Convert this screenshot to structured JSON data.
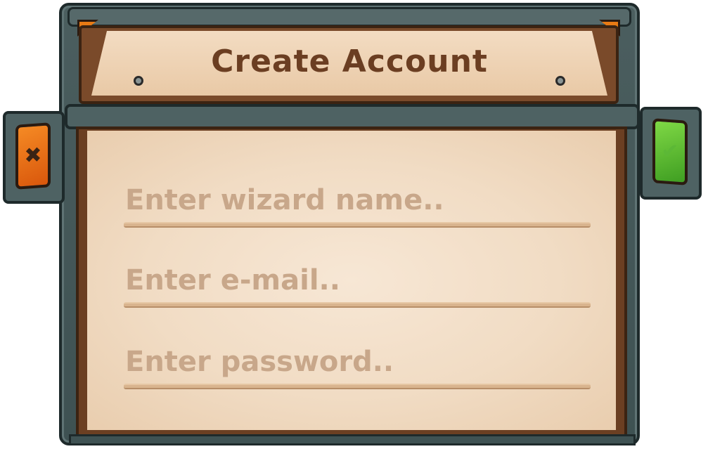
{
  "dialog": {
    "title": "Create Account"
  },
  "form": {
    "fields": [
      {
        "placeholder": "Enter wizard name.."
      },
      {
        "placeholder": "Enter e-mail.."
      },
      {
        "placeholder": "Enter password.."
      }
    ]
  },
  "buttons": {
    "cancel_icon": "close-icon",
    "cancel_color": "#e8701a",
    "confirm_icon": "check-icon",
    "confirm_color": "#5cc236",
    "cancel_glyph": "✖",
    "confirm_glyph": "✔"
  },
  "colors": {
    "frame_stone": "#4b5e5f",
    "wood": "#6b3f22",
    "parchment": "#f1dcc4",
    "title_text": "#6b3e22",
    "placeholder_text": "#c8a78a",
    "corner_gem": "#e87a14"
  }
}
